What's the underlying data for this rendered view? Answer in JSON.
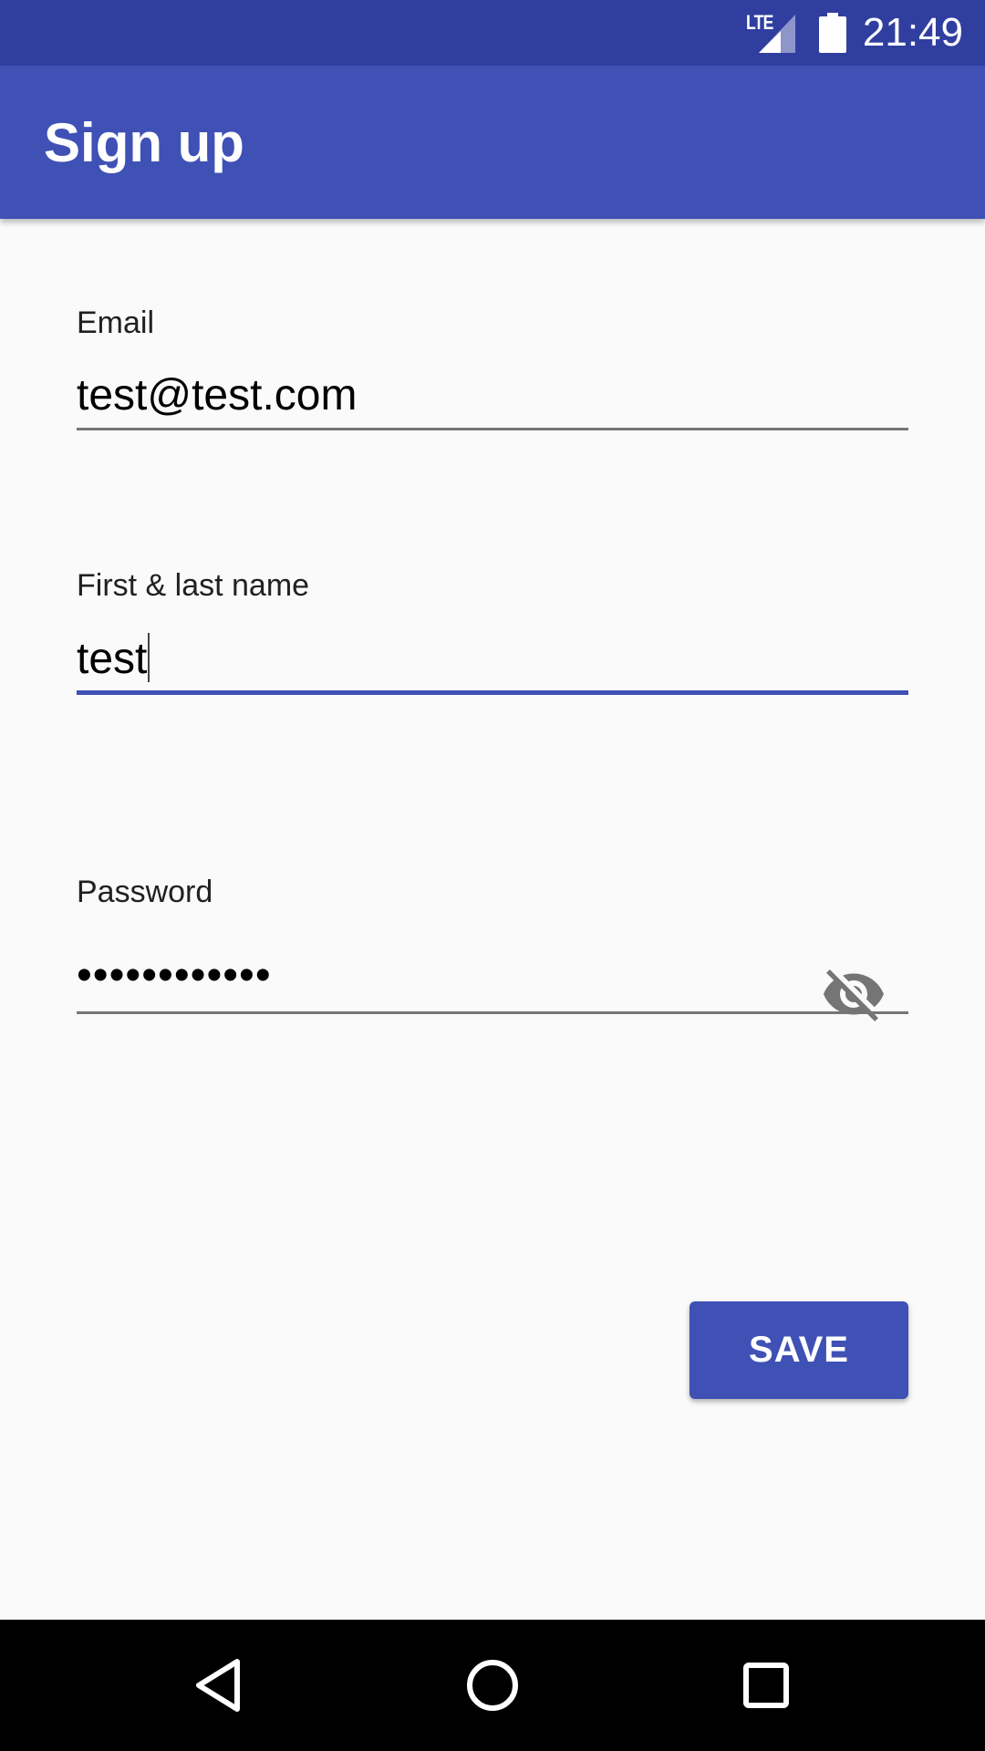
{
  "status_bar": {
    "network_label": "LTE",
    "time": "21:49",
    "icons": [
      "cellular-signal-icon",
      "battery-icon"
    ]
  },
  "app_bar": {
    "title": "Sign up",
    "color": "#3f51b5"
  },
  "form": {
    "email": {
      "label": "Email",
      "value": "test@test.com"
    },
    "name": {
      "label": "First & last name",
      "value": "test",
      "focused": true
    },
    "password": {
      "label": "Password",
      "value_masked": "••••••••••••",
      "toggle_icon": "visibility-off-icon"
    }
  },
  "actions": {
    "save_label": "SAVE"
  },
  "nav_bar": {
    "icons": [
      "back-icon",
      "home-icon",
      "recents-icon"
    ]
  },
  "colors": {
    "primary": "#3f51b5",
    "primary_dark": "#303f9f",
    "background": "#fafafa",
    "nav_background": "#000000"
  }
}
